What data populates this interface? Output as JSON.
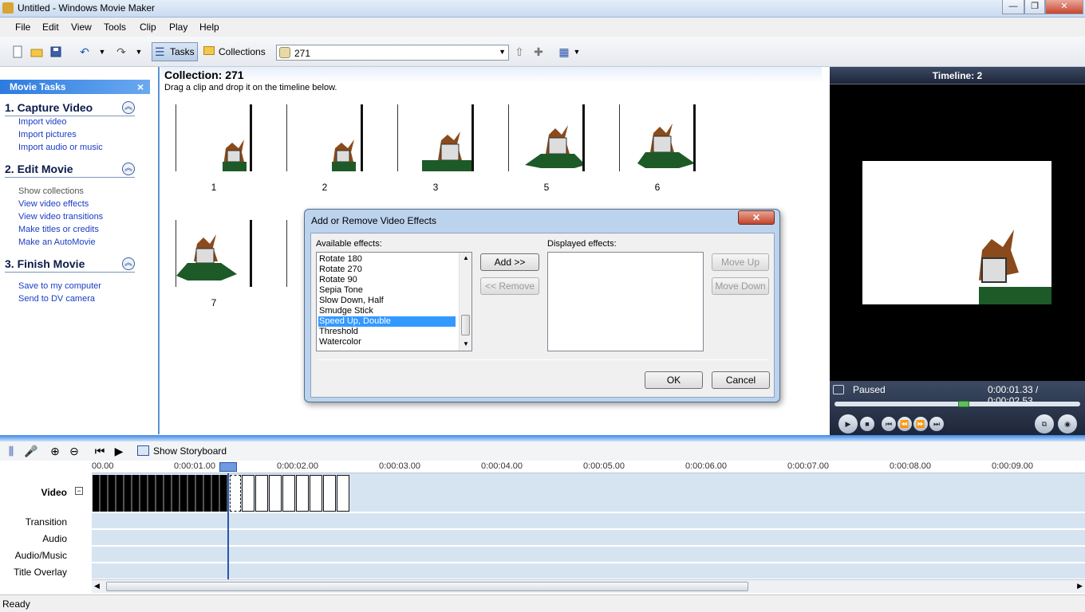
{
  "window": {
    "title": "Untitled - Windows Movie Maker",
    "min": "—",
    "max": "❐",
    "close": "✕"
  },
  "menu": [
    "File",
    "Edit",
    "View",
    "Tools",
    "Clip",
    "Play",
    "Help"
  ],
  "toolbar": {
    "tasks_label": "Tasks",
    "collections_label": "Collections",
    "collection_combo": "271"
  },
  "tasks_pane": {
    "header": "Movie Tasks",
    "close": "×",
    "sections": [
      {
        "title": "1. Capture Video",
        "links": [
          "Import video",
          "Import pictures",
          "Import audio or music"
        ]
      },
      {
        "title": "2. Edit Movie",
        "links": [
          "Show collections",
          "View video effects",
          "View video transitions",
          "Make titles or credits",
          "Make an AutoMovie"
        ]
      },
      {
        "title": "3. Finish Movie",
        "links": [
          "Save to my computer",
          "Send to DV camera"
        ]
      }
    ]
  },
  "collection": {
    "title": "Collection: 271",
    "hint": "Drag a clip and drop it on the timeline below.",
    "clips": [
      "1",
      "2",
      "3",
      "5",
      "6",
      "7"
    ]
  },
  "preview": {
    "title": "Timeline: 2",
    "status": "Paused",
    "time": "0:00:01.33 / 0:00:02.53"
  },
  "dialog": {
    "title": "Add or Remove Video Effects",
    "available_label": "Available effects:",
    "displayed_label": "Displayed effects:",
    "available": [
      "Rotate 180",
      "Rotate 270",
      "Rotate 90",
      "Sepia Tone",
      "Slow Down, Half",
      "Smudge Stick",
      "Speed Up, Double",
      "Threshold",
      "Watercolor"
    ],
    "selected": "Speed Up, Double",
    "add": "Add >>",
    "remove": "<< Remove",
    "move_up": "Move Up",
    "move_down": "Move Down",
    "ok": "OK",
    "cancel": "Cancel"
  },
  "timeline": {
    "show_storyboard": "Show Storyboard",
    "ticks": [
      "00.00",
      "0:00:01.00",
      "0:00:02.00",
      "0:00:03.00",
      "0:00:04.00",
      "0:00:05.00",
      "0:00:06.00",
      "0:00:07.00",
      "0:00:08.00",
      "0:00:09.00"
    ],
    "tracks": [
      "Video",
      "Transition",
      "Audio",
      "Audio/Music",
      "Title Overlay"
    ],
    "collapse": "−"
  },
  "statusbar": {
    "text": "Ready"
  },
  "colors": {
    "accent": "#2d7be0",
    "link": "#1a3cc4",
    "selection": "#3399ff",
    "track": "#d6e4f2"
  }
}
